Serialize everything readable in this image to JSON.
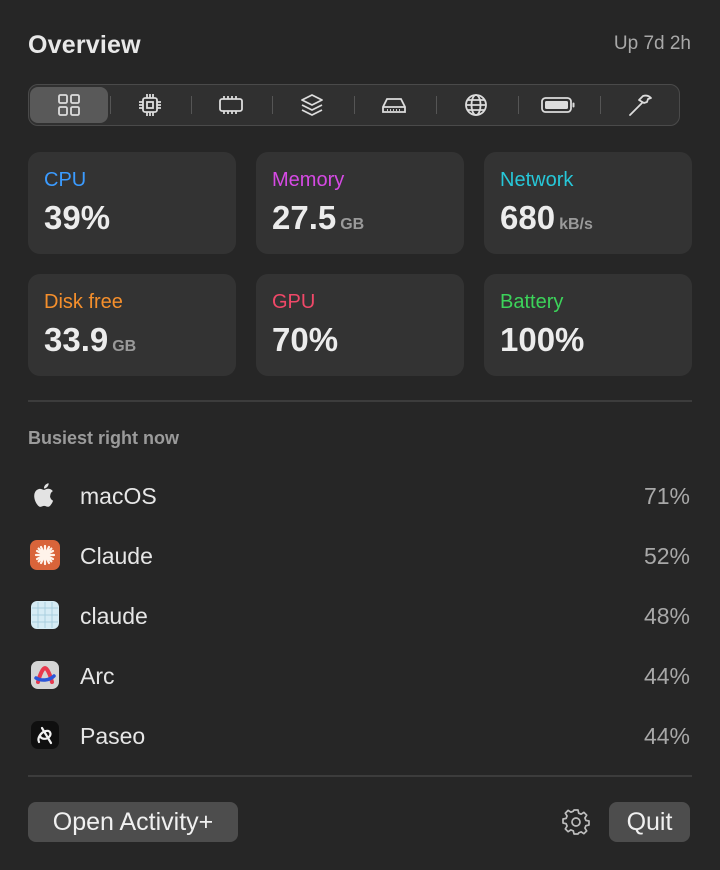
{
  "header": {
    "title": "Overview",
    "uptime": "Up 7d 2h"
  },
  "tabs": [
    {
      "name": "overview",
      "icon": "grid-icon",
      "active": true
    },
    {
      "name": "cpu",
      "icon": "cpu-chip-icon",
      "active": false
    },
    {
      "name": "memory",
      "icon": "memory-icon",
      "active": false
    },
    {
      "name": "layers",
      "icon": "layers-icon",
      "active": false
    },
    {
      "name": "disk",
      "icon": "disk-drive-icon",
      "active": false
    },
    {
      "name": "network",
      "icon": "globe-icon",
      "active": false
    },
    {
      "name": "battery",
      "icon": "battery-icon",
      "active": false
    },
    {
      "name": "tools",
      "icon": "hammer-icon",
      "active": false
    }
  ],
  "stats": {
    "cpu": {
      "label": "CPU",
      "value": "39%",
      "unit": "",
      "color": "#3b9bff"
    },
    "memory": {
      "label": "Memory",
      "value": "27.5",
      "unit": "GB",
      "color": "#d64ae4"
    },
    "network": {
      "label": "Network",
      "value": "680",
      "unit": "kB/s",
      "color": "#27c7d8"
    },
    "disk": {
      "label": "Disk free",
      "value": "33.9",
      "unit": "GB",
      "color": "#f58f2c"
    },
    "gpu": {
      "label": "GPU",
      "value": "70%",
      "unit": "",
      "color": "#f04868"
    },
    "battery": {
      "label": "Battery",
      "value": "100%",
      "unit": "",
      "color": "#3cd35a"
    }
  },
  "busiest": {
    "title": "Busiest right now",
    "items": [
      {
        "name": "macOS",
        "percent": "71%",
        "icon": "apple-icon"
      },
      {
        "name": "Claude",
        "percent": "52%",
        "icon": "claude-app-icon"
      },
      {
        "name": "claude",
        "percent": "48%",
        "icon": "terminal-grid-icon"
      },
      {
        "name": "Arc",
        "percent": "44%",
        "icon": "arc-browser-icon"
      },
      {
        "name": "Paseo",
        "percent": "44%",
        "icon": "paseo-app-icon"
      }
    ]
  },
  "footer": {
    "open_label": "Open Activity+",
    "quit_label": "Quit",
    "settings_icon": "gear-icon"
  }
}
